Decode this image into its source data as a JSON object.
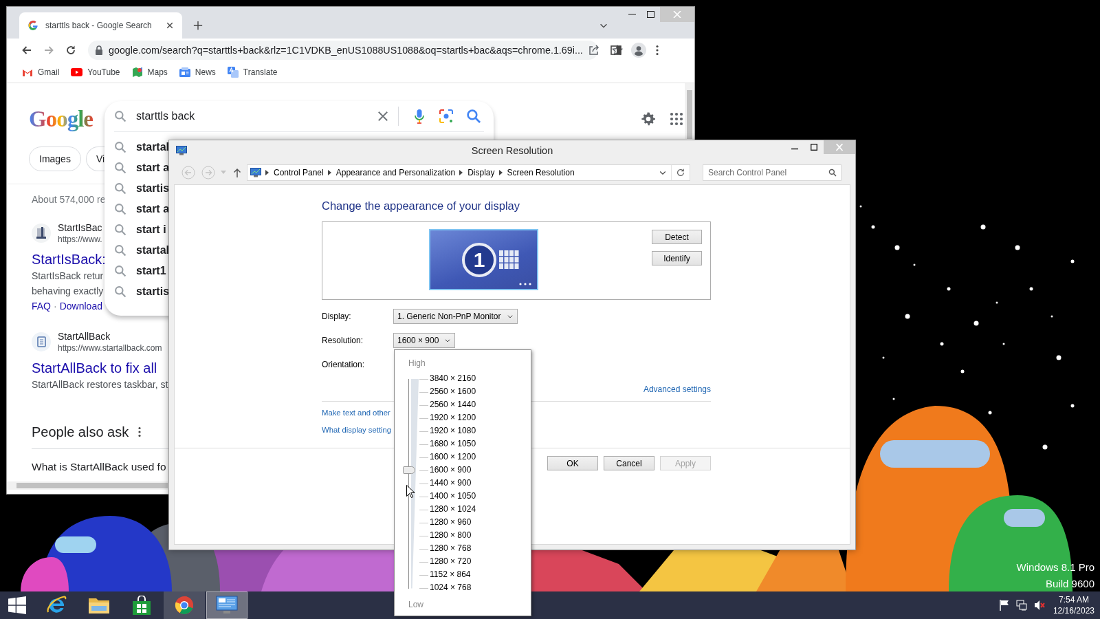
{
  "browser": {
    "tabs": [
      {
        "title": "starttls back - Google Search",
        "selected": true
      }
    ],
    "url": "google.com/search?q=starttls+back&rlz=1C1VDKB_enUS1088US1088&oq=startls+bac&aqs=chrome.1.69i...",
    "bookmarks": [
      {
        "kind": "gmail",
        "label": "Gmail"
      },
      {
        "kind": "youtube",
        "label": "YouTube"
      },
      {
        "kind": "maps",
        "label": "Maps"
      },
      {
        "kind": "news",
        "label": "News"
      },
      {
        "kind": "translate",
        "label": "Translate"
      }
    ],
    "logo": "Google",
    "search": {
      "value": "starttls back"
    },
    "suggestions": [
      "startal",
      "start a",
      "startis",
      "start a",
      "start i",
      "startal",
      "start1",
      "startis"
    ],
    "chips": [
      "Images",
      "Vi"
    ],
    "result_stats": "About 574,000 re",
    "results": [
      {
        "site": "StartIsBac",
        "url": "https://www.",
        "title": "StartIsBack:",
        "snippet": [
          "StartIsBack retur",
          "behaving exactly"
        ],
        "links": [
          "FAQ",
          "Download"
        ],
        "link_separator": "·"
      },
      {
        "site": "StartAllBack",
        "url": "https://www.startallback.com",
        "title": "StartAllBack to fix all",
        "snippet": [
          "StartAllBack restores taskbar, st"
        ]
      }
    ],
    "people_also_ask": {
      "title": "People also ask",
      "question": "What is StartAllBack used fo"
    }
  },
  "control_panel": {
    "title": "Screen Resolution",
    "breadcrumb": [
      "Control Panel",
      "Appearance and Personalization",
      "Display",
      "Screen Resolution"
    ],
    "search": {
      "placeholder": "Search Control Panel"
    },
    "heading": "Change the appearance of your display",
    "monitor_label": "1",
    "side_buttons": [
      "Detect",
      "Identify"
    ],
    "fields": [
      {
        "label": "Display:",
        "value": "1. Generic Non-PnP Monitor"
      },
      {
        "label": "Resolution:",
        "value": "1600 × 900"
      },
      {
        "label": "Orientation:"
      }
    ],
    "advanced_link": "Advanced settings",
    "links": [
      "Make text and other",
      "What display setting"
    ],
    "buttons": [
      {
        "label": "OK",
        "disabled": false
      },
      {
        "label": "Cancel",
        "disabled": false
      },
      {
        "label": "Apply",
        "disabled": true
      }
    ]
  },
  "resolution_menu": {
    "high_label": "High",
    "options": [
      "3840 × 2160",
      "2560 × 1600",
      "2560 × 1440",
      "1920 × 1200",
      "1920 × 1080",
      "1680 × 1050",
      "1600 × 1200",
      "1600 × 900",
      "1440 × 900",
      "1400 × 1050",
      "1280 × 1024",
      "1280 × 960",
      "1280 × 800",
      "1280 × 768",
      "1280 × 720",
      "1152 × 864",
      "1024 × 768"
    ],
    "level": 0.5625,
    "low_label": "Low"
  },
  "desktop": {
    "version_lines": [
      "Windows 8.1 Pro",
      "Build 9600"
    ]
  },
  "taskbar": {
    "apps": [
      {
        "kind": "ie",
        "running": false,
        "selected": false
      },
      {
        "kind": "explorer",
        "running": false,
        "selected": false
      },
      {
        "kind": "store",
        "running": false,
        "selected": false
      },
      {
        "kind": "chrome",
        "running": true,
        "selected": false
      },
      {
        "kind": "control_panel",
        "running": true,
        "selected": true
      }
    ],
    "clock": {
      "time": "7:54 AM",
      "date": "12/16/2023"
    }
  }
}
